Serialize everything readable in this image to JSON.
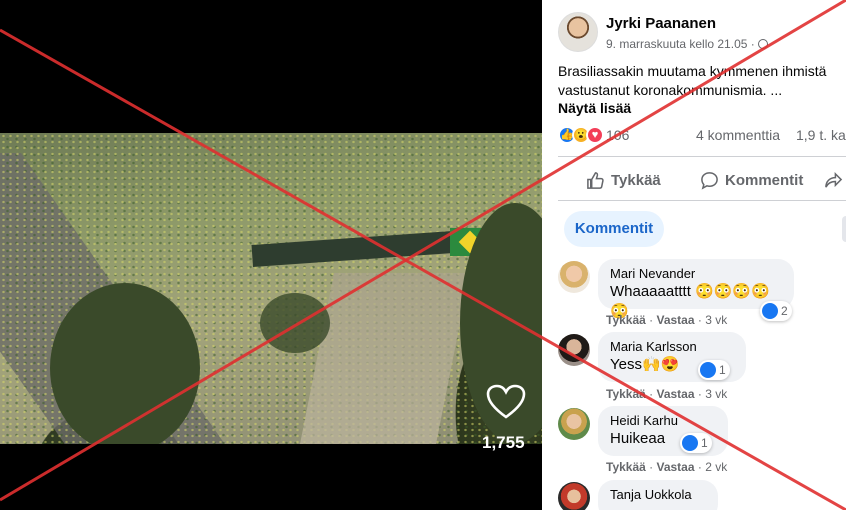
{
  "video": {
    "like_count": "1,755",
    "heart_icon": "heart-outline-icon"
  },
  "post": {
    "author": "Jyrki Paananen",
    "date": "9. marraskuuta kello 21.05 ·",
    "privacy_icon": "globe-icon",
    "text_line1": "Brasiliassakin muutama kymmenen ihmistä",
    "text_line2": "vastustanut koronakommunismia. ...",
    "see_more": "Näytä lisää",
    "reactions": [
      "like",
      "wow",
      "love"
    ],
    "reaction_count": "106",
    "comment_count": "4 kommenttia",
    "share_count": "1,9 t. ka",
    "actions": {
      "like": "Tykkää",
      "comment": "Kommentit"
    },
    "comments_tab": "Kommentit"
  },
  "comments": [
    {
      "name": "Mari Nevander",
      "text": "Whaaaaatttt 😳😳😳😳😳",
      "like": "Tykkää",
      "reply": "Vastaa",
      "age": "3 vk",
      "reaction_count": "2"
    },
    {
      "name": "Maria Karlsson",
      "text": "Yess🙌😍",
      "like": "Tykkää",
      "reply": "Vastaa",
      "age": "3 vk",
      "reaction_count": "1"
    },
    {
      "name": "Heidi Karhu",
      "text": "Huikeaa",
      "like": "Tykkää",
      "reply": "Vastaa",
      "age": "2 vk",
      "reaction_count": "1"
    },
    {
      "name": "Tanja Uokkola"
    }
  ],
  "colors": {
    "overlay_cross": "#e03030",
    "facebook_blue": "#1877f2",
    "tab_bg": "#e7f3ff"
  }
}
